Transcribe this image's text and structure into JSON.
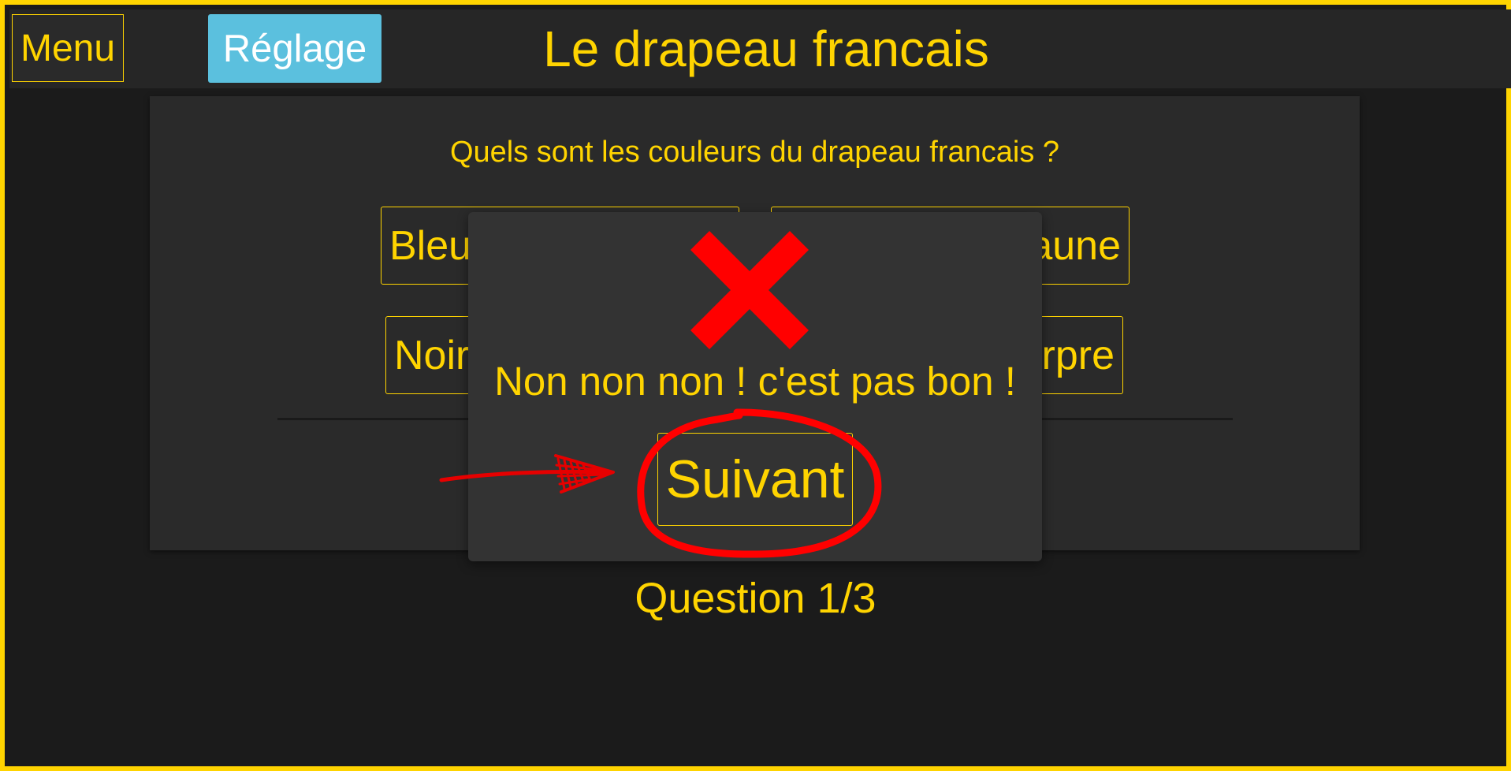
{
  "header": {
    "menu_label": "Menu",
    "settings_label": "Réglage",
    "title": "Le drapeau francais"
  },
  "quiz": {
    "question": "Quels sont les couleurs du drapeau francais ?",
    "answers": [
      {
        "label": "Bleu Blanc Rouge"
      },
      {
        "label": "Rouge Vert Jaune"
      },
      {
        "label": "Noir Blanc Gris"
      },
      {
        "label": "Violet Pourpre"
      }
    ],
    "progress": "Question 1/3",
    "current_question": 1,
    "total_questions": 3
  },
  "modal": {
    "icon": "close-icon",
    "icon_color": "#ff0000",
    "message": "Non non non ! c'est pas bon !",
    "next_label": "Suivant"
  },
  "theme": {
    "accent": "#ffd400",
    "settings_button": "#5bc0de",
    "background": "#1b1b1b",
    "card": "#2a2a2a",
    "modal": "#333333",
    "annotation": "#ff0000"
  }
}
